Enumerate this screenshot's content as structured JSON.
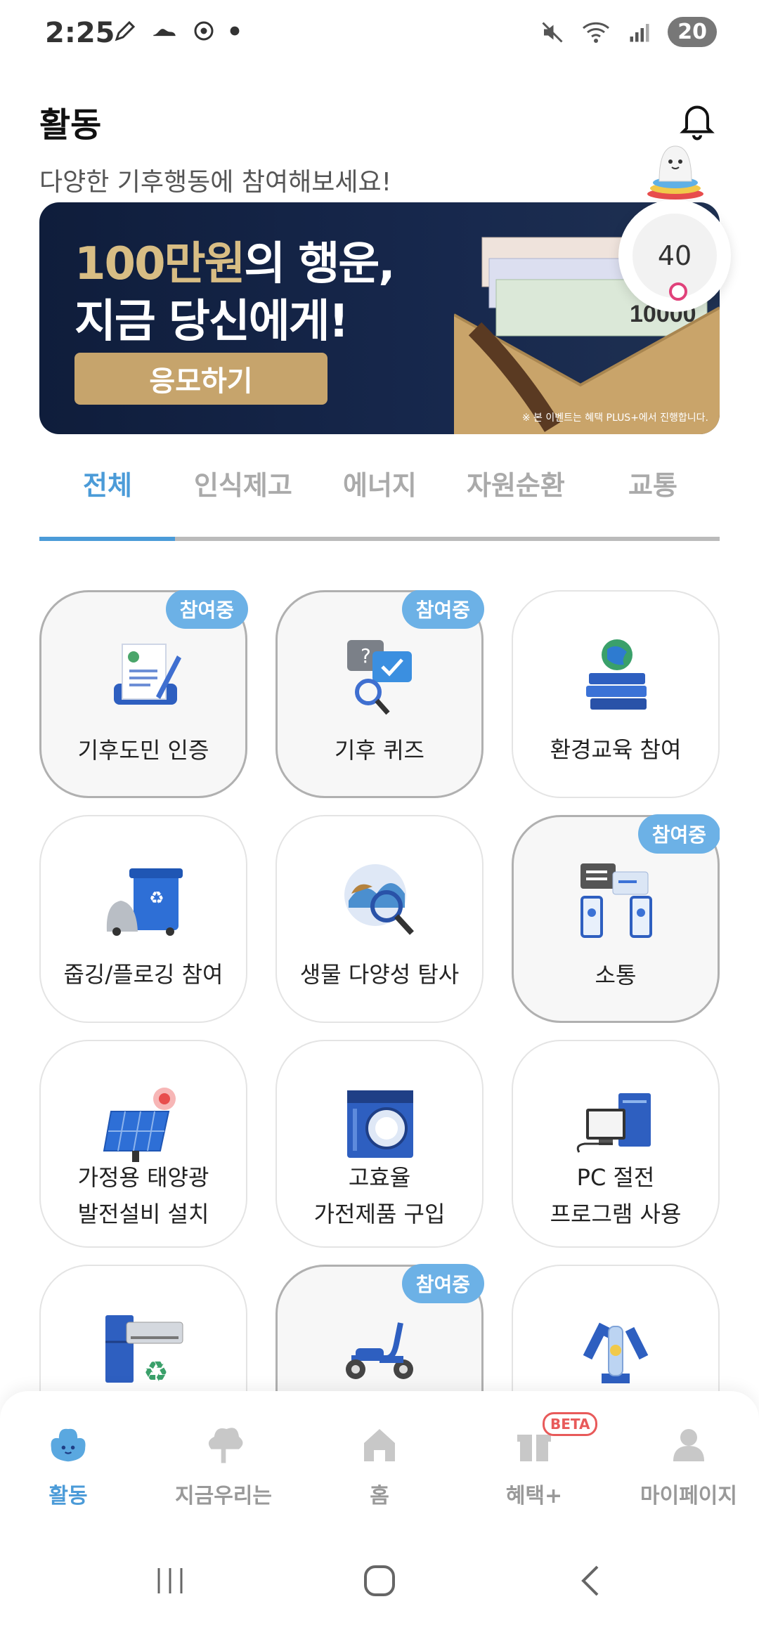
{
  "status_bar": {
    "time": "2:25",
    "battery": "20"
  },
  "header": {
    "title": "활동",
    "subtitle": "다양한 기후행동에 참여해보세요!"
  },
  "banner": {
    "line1_highlight": "100만원",
    "line1_rest": "의 행운,",
    "line2": "지금 당신에게!",
    "button": "응모하기",
    "note": "※ 본 이벤트는 혜택 PLUS+에서 진행합니다.",
    "bill_value": "10000"
  },
  "counter": {
    "value": "40"
  },
  "tabs": [
    {
      "label": "전체",
      "active": true
    },
    {
      "label": "인식제고"
    },
    {
      "label": "에너지"
    },
    {
      "label": "자원순환"
    },
    {
      "label": "교통"
    }
  ],
  "badge_label": "참여중",
  "cards": [
    {
      "label": "기후도민 인증",
      "joined": true,
      "icon": "document-pen-icon"
    },
    {
      "label": "기후 퀴즈",
      "joined": true,
      "icon": "quiz-icon"
    },
    {
      "label": "환경교육 참여",
      "joined": false,
      "icon": "books-globe-icon"
    },
    {
      "label": "줍깅/플로깅 참여",
      "joined": false,
      "icon": "recycle-bin-icon"
    },
    {
      "label": "생물 다양성 탐사",
      "joined": false,
      "icon": "magnifier-globe-icon"
    },
    {
      "label": "소통",
      "joined": true,
      "icon": "phones-chat-icon"
    },
    {
      "label_line1": "가정용 태양광",
      "label_line2": "발전설비 설치",
      "joined": false,
      "icon": "solar-panel-icon"
    },
    {
      "label_line1": "고효율",
      "label_line2": "가전제품 구입",
      "joined": false,
      "icon": "washing-machine-icon"
    },
    {
      "label_line1": "PC 절전",
      "label_line2": "프로그램 사용",
      "joined": false,
      "icon": "pc-icon"
    },
    {
      "label": "",
      "joined": false,
      "icon": "appliance-recycle-icon"
    },
    {
      "label": "",
      "joined": true,
      "icon": "scooter-icon"
    },
    {
      "label": "",
      "joined": false,
      "icon": "bottle-recycle-icon"
    }
  ],
  "bottom_nav": [
    {
      "label": "활동",
      "active": true,
      "icon": "activity-icon"
    },
    {
      "label": "지금우리는",
      "icon": "tree-icon"
    },
    {
      "label": "홈",
      "icon": "home-icon"
    },
    {
      "label": "혜택+",
      "icon": "gift-icon",
      "badge": "BETA"
    },
    {
      "label": "마이페이지",
      "icon": "person-icon"
    }
  ],
  "colors": {
    "accent": "#4b9bd8",
    "badge": "#6cb1e6",
    "banner_bg": "#0f1d3b",
    "gold": "#c6a46c"
  }
}
